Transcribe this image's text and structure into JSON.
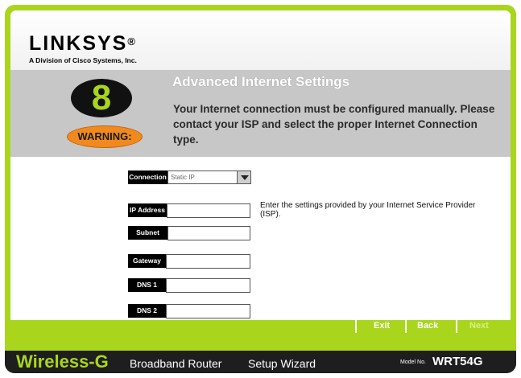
{
  "brand": {
    "name": "LINKSYS",
    "mark": "®",
    "sub": "A Division of Cisco Systems, Inc."
  },
  "step": {
    "number": "8",
    "warning": "WARNING:"
  },
  "heading": {
    "title": "Advanced Internet Settings",
    "message": "Your Internet connection must be configured manually. Please contact your ISP and select the proper Internet Connection type."
  },
  "form": {
    "connection": {
      "label": "Connection",
      "value": "Static IP"
    },
    "ip_address": {
      "label": "IP Address",
      "value": ""
    },
    "subnet_mask": {
      "label": "Subnet Mask",
      "value": ""
    },
    "gateway": {
      "label": "Gateway",
      "value": ""
    },
    "dns1": {
      "label": "DNS 1",
      "value": ""
    },
    "dns2": {
      "label": "DNS 2",
      "value": ""
    }
  },
  "help": "Enter the settings provided by your Internet Service Provider (ISP).",
  "nav": {
    "exit": "Exit",
    "back": "Back",
    "next": "Next"
  },
  "footer": {
    "product": "Wireless-G",
    "product_desc": "Broadband Router",
    "wizard": "Setup Wizard",
    "model_label": "Model No.",
    "model": "WRT54G"
  },
  "colors": {
    "accent_green": "#a9d61c",
    "warning_orange": "#f08a1e",
    "band_gray": "#c7c7c7",
    "footer_black": "#1e1e1e"
  }
}
